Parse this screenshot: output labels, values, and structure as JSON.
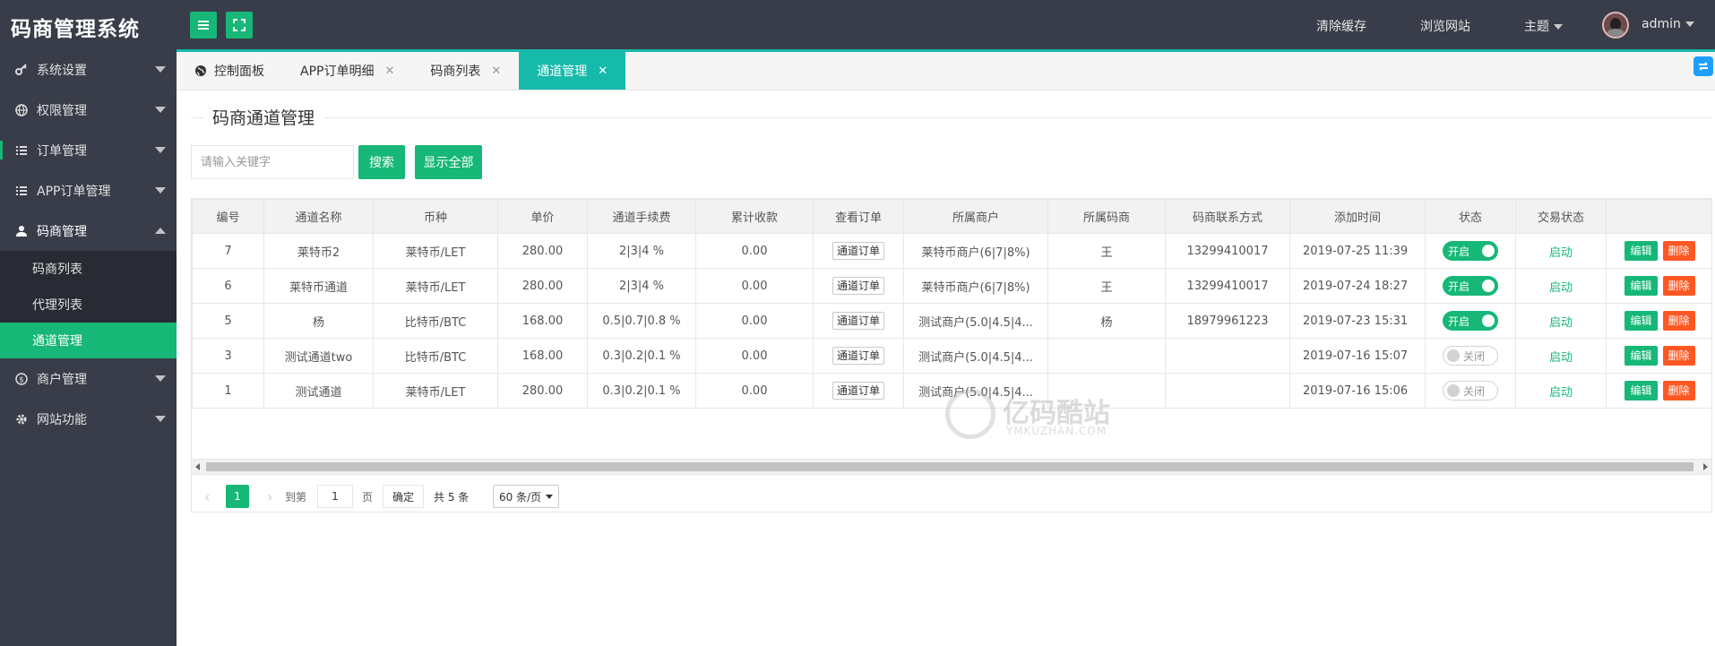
{
  "header": {
    "logo": "码商管理系统",
    "links": [
      {
        "label": "清除缓存"
      },
      {
        "label": "浏览网站"
      },
      {
        "label": "主题"
      }
    ],
    "user": "admin"
  },
  "sidebar": {
    "items": [
      {
        "label": "系统设置",
        "icon": "key-icon"
      },
      {
        "label": "权限管理",
        "icon": "globe-icon"
      },
      {
        "label": "订单管理",
        "icon": "list-icon"
      },
      {
        "label": "APP订单管理",
        "icon": "list-icon"
      },
      {
        "label": "码商管理",
        "icon": "user-icon"
      },
      {
        "label": "商户管理",
        "icon": "dollar-circle-icon"
      },
      {
        "label": "网站功能",
        "icon": "gear-icon"
      }
    ],
    "subitems": [
      {
        "label": "码商列表"
      },
      {
        "label": "代理列表"
      },
      {
        "label": "通道管理"
      }
    ]
  },
  "tabs": [
    {
      "label": "控制面板"
    },
    {
      "label": "APP订单明细"
    },
    {
      "label": "码商列表"
    },
    {
      "label": "通道管理"
    }
  ],
  "page": {
    "legend": "码商通道管理",
    "search_placeholder": "请输入关键字",
    "search_btn": "搜索",
    "show_all_btn": "显示全部"
  },
  "table": {
    "columns": [
      "编号",
      "通道名称",
      "币种",
      "单价",
      "通道手续费",
      "累计收款",
      "查看订单",
      "所属商户",
      "所属码商",
      "码商联系方式",
      "添加时间",
      "状态",
      "交易状态",
      ""
    ],
    "rows": [
      {
        "id": "7",
        "name": "莱特币2",
        "currency": "莱特币/LET",
        "price": "280.00",
        "fee": "2|3|4 %",
        "total": "0.00",
        "view": "通道订单",
        "merchant": "莱特币商户(6|7|8%)",
        "agent": "王",
        "contact": "13299410017",
        "time": "2019-07-25 11:39",
        "status": "开启",
        "status_on": true,
        "trade": "启动",
        "edit": "编辑",
        "del": "删除"
      },
      {
        "id": "6",
        "name": "莱特币通道",
        "currency": "莱特币/LET",
        "price": "280.00",
        "fee": "2|3|4 %",
        "total": "0.00",
        "view": "通道订单",
        "merchant": "莱特币商户(6|7|8%)",
        "agent": "王",
        "contact": "13299410017",
        "time": "2019-07-24 18:27",
        "status": "开启",
        "status_on": true,
        "trade": "启动",
        "edit": "编辑",
        "del": "删除"
      },
      {
        "id": "5",
        "name": "杨",
        "currency": "比特币/BTC",
        "price": "168.00",
        "fee": "0.5|0.7|0.8 %",
        "total": "0.00",
        "view": "通道订单",
        "merchant": "测试商户(5.0|4.5|4...",
        "agent": "杨",
        "contact": "18979961223",
        "time": "2019-07-23 15:31",
        "status": "开启",
        "status_on": true,
        "trade": "启动",
        "edit": "编辑",
        "del": "删除"
      },
      {
        "id": "3",
        "name": "测试通道two",
        "currency": "比特币/BTC",
        "price": "168.00",
        "fee": "0.3|0.2|0.1 %",
        "total": "0.00",
        "view": "通道订单",
        "merchant": "测试商户(5.0|4.5|4...",
        "agent": "",
        "contact": "",
        "time": "2019-07-16 15:07",
        "status": "关闭",
        "status_on": false,
        "trade": "启动",
        "edit": "编辑",
        "del": "删除"
      },
      {
        "id": "1",
        "name": "测试通道",
        "currency": "莱特币/LET",
        "price": "280.00",
        "fee": "0.3|0.2|0.1 %",
        "total": "0.00",
        "view": "通道订单",
        "merchant": "测试商户(5.0|4.5|4...",
        "agent": "",
        "contact": "",
        "time": "2019-07-16 15:06",
        "status": "关闭",
        "status_on": false,
        "trade": "启动",
        "edit": "编辑",
        "del": "删除"
      }
    ]
  },
  "pager": {
    "current": "1",
    "goto_label": "到第",
    "page_input": "1",
    "page_unit": "页",
    "confirm": "确定",
    "total": "共 5 条",
    "page_size": "60 条/页"
  },
  "watermark": {
    "text": "亿码酷站",
    "sub": "YMKUZHAN.COM"
  },
  "colors": {
    "header_bg": "#393d49",
    "accent_green": "#16b777",
    "tab_active": "#16baaa",
    "delete_orange": "#ff5722"
  }
}
